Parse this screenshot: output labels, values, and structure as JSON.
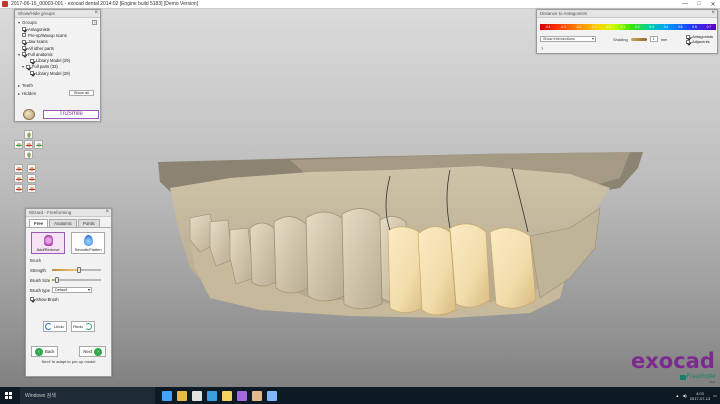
{
  "titlebar": {
    "title": "2017-06-15_00003-001 - exocad dental 2014:02 [Engine build 5183] [Demo Version]",
    "minimize": "—",
    "maximize": "□",
    "close": "✕"
  },
  "groups_panel": {
    "title": "Show/Hide groups",
    "close": "×",
    "groups_label": "Groups",
    "help": "?",
    "items": [
      {
        "label": "Antagonists",
        "checked": true
      },
      {
        "label": "Pre-op/Waxup scans",
        "checked": false
      },
      {
        "label": "Jaw scans",
        "checked": true
      },
      {
        "label": "All other parts",
        "checked": true
      },
      {
        "label": "Full anatomic",
        "checked": true
      },
      {
        "label": "Library Model (29)",
        "checked": true
      },
      {
        "label": "Full parts (33)",
        "checked": true
      },
      {
        "label": "Library Model (29)",
        "checked": true
      }
    ],
    "teeth_label": "Teeth",
    "hidden_label": "Hidden",
    "show_all": "Show all",
    "trusmile": "TruSmile"
  },
  "distance_panel": {
    "title": "Distance to Antagonists",
    "close": "×",
    "scale_labels": [
      "-0.4",
      "-0.3",
      "-0.2",
      "-0.1",
      "0.0",
      "0.1",
      "0.2",
      "0.3",
      "0.4",
      "0.5",
      "0.6",
      "0.7"
    ],
    "show_intersections": "Show intersections",
    "shading_label": "Shading",
    "shading_value": "1",
    "shading_unit": "mm",
    "antagonists_label": "Antagonists",
    "adjacents_label": "Adjacents",
    "help": "?"
  },
  "wizard_panel": {
    "title": "Wizard - Freeforming",
    "close": "×",
    "tabs": [
      "Free",
      "Anatomic",
      "Pontic"
    ],
    "tools": {
      "add_remove": "Add/Remove",
      "smooth_flatten": "Smooth/Flatten"
    },
    "brush_section": "Brush",
    "strength_label": "Strength",
    "strength_value": 0.55,
    "brush_size_label": "Brush Size",
    "brush_size_value": 0.1,
    "brush_type_label": "Brush type",
    "brush_type_value": "Default",
    "show_brush": "Show Brush",
    "undo": "Undo",
    "redo": "Redo",
    "back": "Back",
    "next": "Next",
    "hint": "Next' to adapt to pre-op model"
  },
  "logo": {
    "brand": "exocad",
    "partner": "Fraunhofer",
    "sub": "IGD"
  },
  "taskbar": {
    "search": "Windows 검색",
    "clock_time": "4:03",
    "clock_date": "2017-07-13",
    "icon_colors": [
      "#3fa3ff",
      "#e8b84a",
      "#e0e0e0",
      "#3aa0e0",
      "#f4d35e",
      "#a66ad8",
      "#e3b88a",
      "#7fb8ff"
    ]
  },
  "colors": {
    "brand": "#7d2a8f",
    "tooth": "#d8cdb3",
    "restoration": "#f1dcab"
  }
}
